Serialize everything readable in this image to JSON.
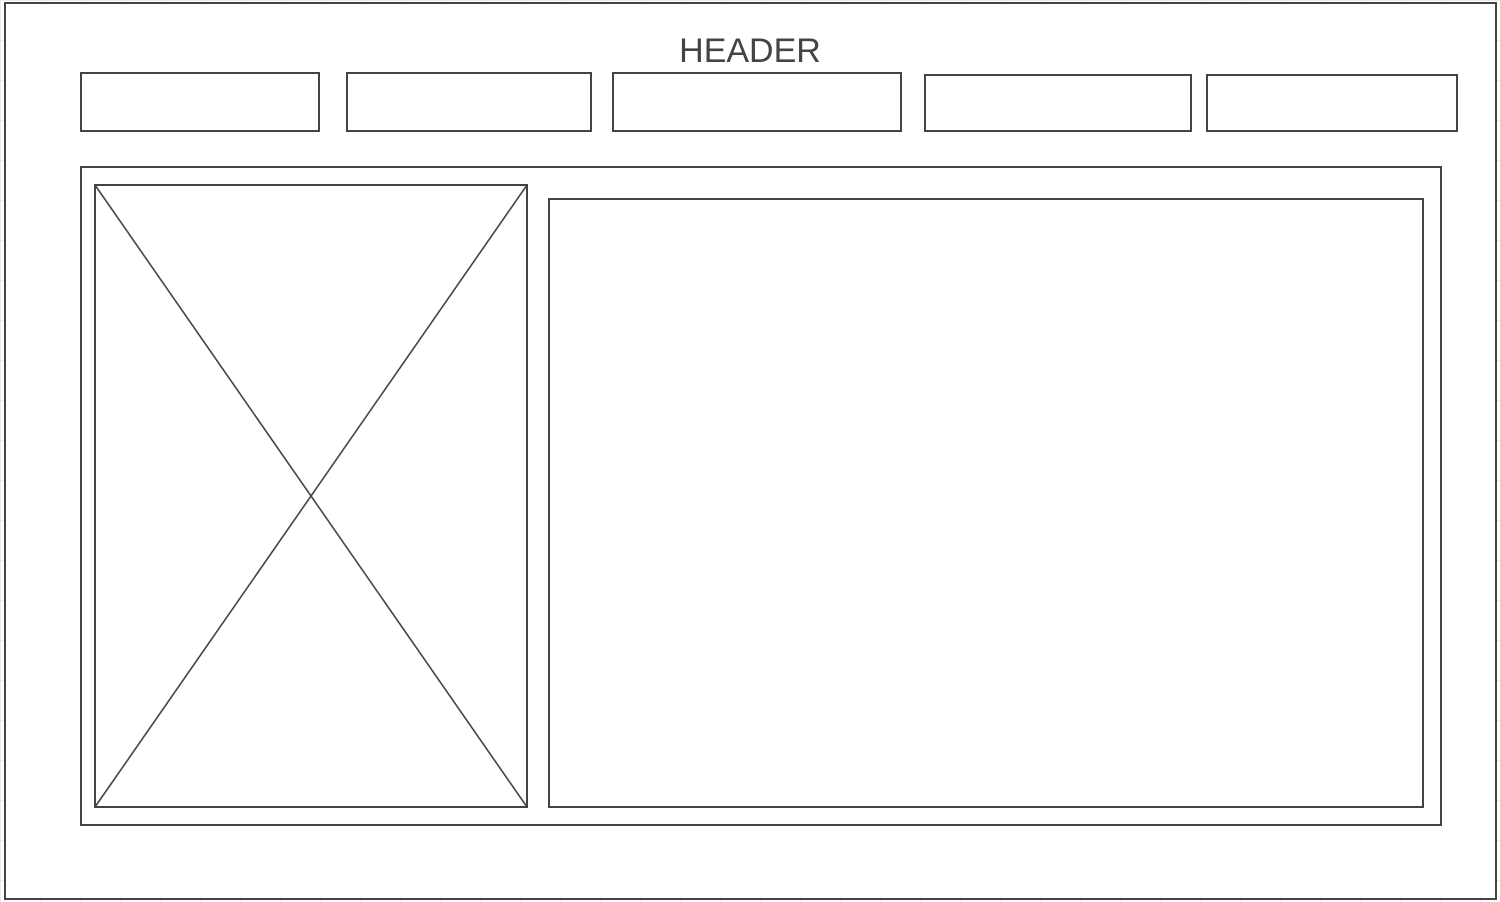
{
  "header": {
    "title": "HEADER"
  },
  "nav": {
    "items": [
      {
        "label": ""
      },
      {
        "label": ""
      },
      {
        "label": ""
      },
      {
        "label": ""
      },
      {
        "label": ""
      }
    ]
  },
  "main": {
    "image_placeholder": {
      "icon": "image-placeholder-x-icon"
    },
    "content": {
      "text": ""
    }
  },
  "colors": {
    "stroke": "#444444",
    "background": "#ffffff",
    "grid": "#ebebeb"
  }
}
